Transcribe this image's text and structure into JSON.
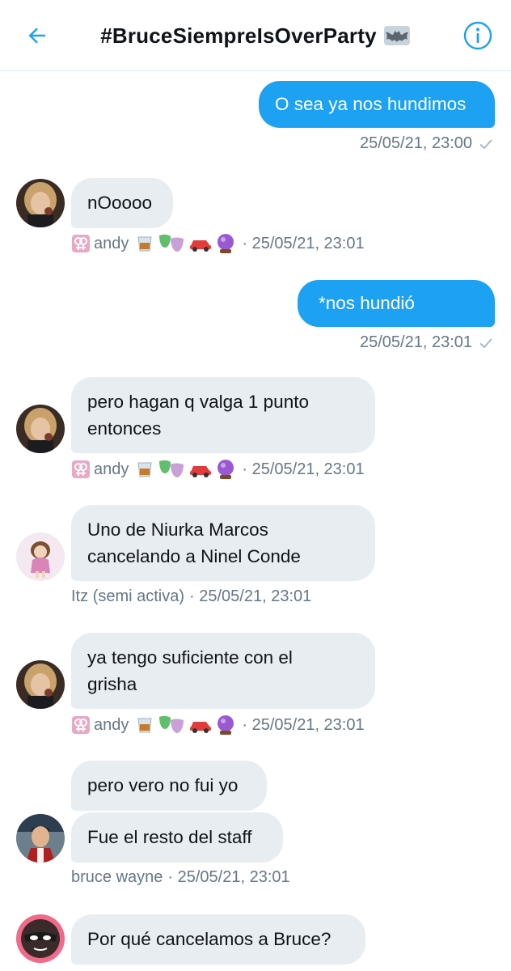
{
  "header": {
    "title": "#BruceSiempreIsOverParty",
    "back_icon": "arrow-left-icon",
    "info_icon": "info-circle-icon",
    "title_icon": "bat-icon",
    "accent": "#1da1f2"
  },
  "messages": [
    {
      "text": "O sea ya nos hundimos",
      "meta": "25/05/21, 23:00"
    },
    {
      "text": "nOoooo",
      "sender": "andy",
      "time": "· 25/05/21, 23:01"
    },
    {
      "text": "*nos hundió",
      "meta": "25/05/21, 23:01"
    },
    {
      "line1": "pero hagan q valga 1 punto",
      "line2": "entonces",
      "sender": "andy",
      "time": "· 25/05/21, 23:01"
    },
    {
      "line1": "Uno de Niurka Marcos",
      "line2": "cancelando a Ninel Conde",
      "sender": "Itz (semi activa)",
      "time": "· 25/05/21, 23:01"
    },
    {
      "line1": "ya tengo suficiente con el",
      "line2": "grisha",
      "sender": "andy",
      "time": "· 25/05/21, 23:01"
    },
    {
      "text": "pero vero no fui yo"
    },
    {
      "text": "Fue el resto del staff",
      "sender": "bruce wayne",
      "time": "· 25/05/21, 23:01"
    },
    {
      "text": "Por qué cancelamos a Bruce?"
    }
  ],
  "colors": {
    "incoming_bubble": "#e8edf1",
    "outgoing_bubble": "#1da1f2",
    "meta_text": "#657786"
  }
}
